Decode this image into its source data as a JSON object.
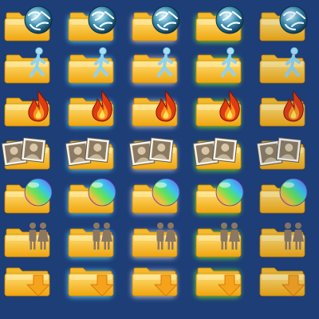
{
  "background": "#1d3e77",
  "icon_rows": [
    {
      "name": "globe-icon"
    },
    {
      "name": "walking-person-icon"
    },
    {
      "name": "fire-icon"
    },
    {
      "name": "photos-icon"
    },
    {
      "name": "rainbow-ball-icon"
    },
    {
      "name": "people-icon"
    },
    {
      "name": "down-arrow-icon"
    }
  ],
  "state_columns": [
    {
      "state": "normal",
      "glow": ""
    },
    {
      "state": "hover",
      "glow": "#57c6f2"
    },
    {
      "state": "pressed",
      "glow": "#b8c3d6"
    },
    {
      "state": "selected",
      "glow": "#6bd43b"
    },
    {
      "state": "disabled",
      "glow": ""
    }
  ],
  "folder_colors": {
    "body_top": "#ffe07a",
    "body_bottom": "#f0a50c",
    "tab": "#f5b82a",
    "edge": "#c98400"
  }
}
